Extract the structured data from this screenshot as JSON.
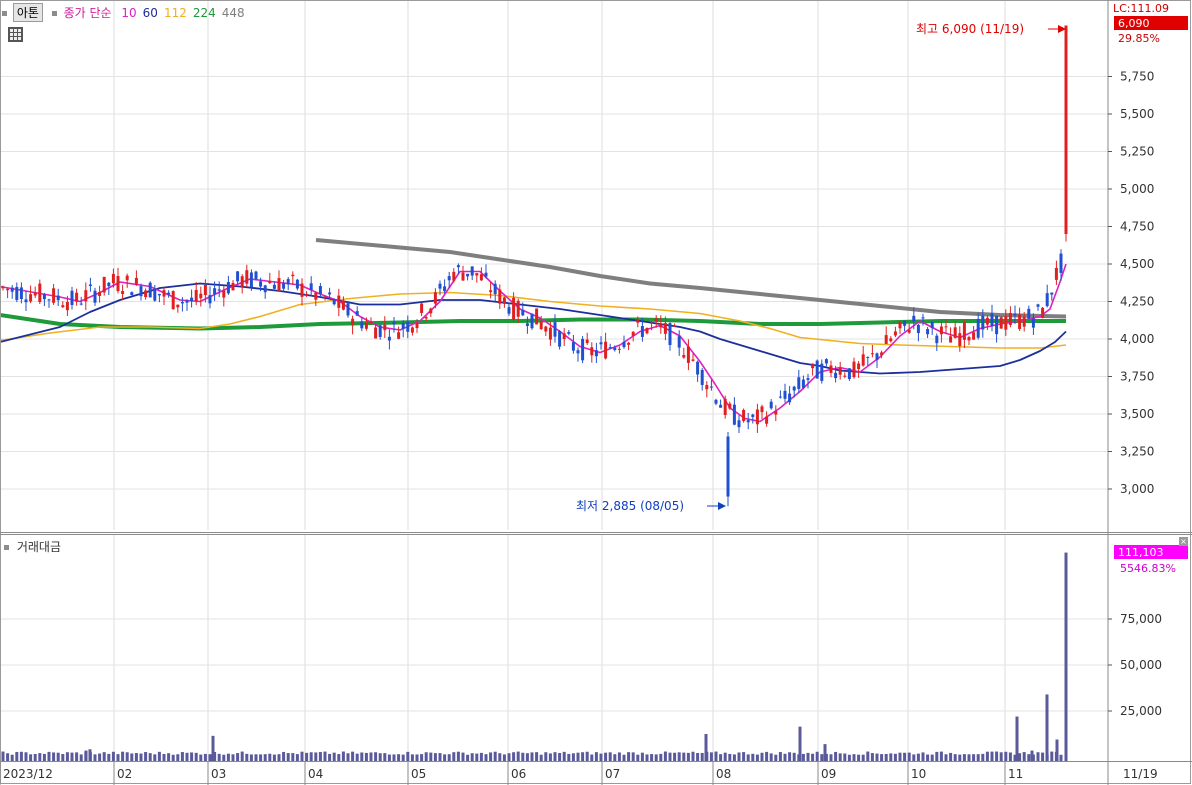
{
  "header": {
    "stock_button": "아톤",
    "ma_title": "종가 단순",
    "ma_periods": [
      "10",
      "60",
      "112",
      "224",
      "448"
    ],
    "ma_colors": [
      "#e020c0",
      "#1c2f9c",
      "#f0b020",
      "#1f9a3a",
      "#7f7f7f"
    ]
  },
  "volume_panel": {
    "title": "거래대금"
  },
  "price_axis": {
    "corner_label": "LC:111.09",
    "current_tag": "6,090",
    "current_pct": "29.85%",
    "tick_labels": [
      "5,750",
      "5,500",
      "5,250",
      "5,000",
      "4,750",
      "4,500",
      "4,250",
      "4,000",
      "3,750",
      "3,500",
      "3,250",
      "3,000"
    ],
    "ticks": [
      5750,
      5500,
      5250,
      5000,
      4750,
      4500,
      4250,
      4000,
      3750,
      3500,
      3250,
      3000
    ]
  },
  "volume_axis": {
    "current_tag": "111,103",
    "current_pct": "5546.83%",
    "tick_labels": [
      "75,000",
      "50,000",
      "25,000"
    ],
    "ticks": [
      75000,
      50000,
      25000
    ]
  },
  "time_axis": {
    "labels": [
      "2023/12",
      "02",
      "03",
      "04",
      "05",
      "06",
      "07",
      "08",
      "09",
      "10",
      "11"
    ],
    "right_label": "11/19"
  },
  "annotations": {
    "high_text": "최고 6,090 (11/19)",
    "low_text": "최저 2,885 (08/05)"
  },
  "colors": {
    "up": "#e02020",
    "down": "#2050d0",
    "volume": "#5a5a9a",
    "highlight": "#ff00ff",
    "price_tag": "#e00000"
  },
  "chart_data": {
    "type": "candlestick",
    "price_range": [
      2800,
      6100
    ],
    "volume_range": [
      0,
      115000
    ],
    "high": {
      "value": 6090,
      "date": "11/19"
    },
    "low": {
      "value": 2885,
      "date": "08/05"
    },
    "last_close": 6090,
    "last_volume": 111103,
    "series": [
      {
        "name": "10",
        "x": [
          0,
          60,
          80,
          100,
          120,
          150,
          180,
          200,
          225,
          250,
          275,
          300,
          320,
          340,
          360,
          380,
          400,
          420,
          440,
          460,
          480,
          500,
          520,
          540,
          560,
          580,
          600,
          620,
          640,
          660,
          680,
          700,
          715,
          730,
          745,
          760,
          780,
          800,
          820,
          840,
          860,
          880,
          900,
          920,
          940,
          960,
          980,
          1000,
          1020,
          1040,
          1050,
          1060,
          1066
        ],
        "y": [
          4350,
          4280,
          4250,
          4310,
          4380,
          4350,
          4260,
          4250,
          4330,
          4400,
          4380,
          4360,
          4300,
          4250,
          4150,
          4080,
          4060,
          4120,
          4250,
          4450,
          4450,
          4320,
          4200,
          4140,
          4050,
          3950,
          3910,
          3960,
          4050,
          4090,
          4020,
          3850,
          3700,
          3540,
          3470,
          3450,
          3540,
          3650,
          3780,
          3810,
          3780,
          3880,
          4020,
          4120,
          4050,
          4010,
          4070,
          4100,
          4120,
          4150,
          4200,
          4380,
          4500
        ]
      },
      {
        "name": "60",
        "x": [
          0,
          60,
          90,
          120,
          160,
          200,
          240,
          280,
          320,
          360,
          400,
          440,
          480,
          520,
          560,
          600,
          640,
          680,
          700,
          720,
          740,
          760,
          780,
          800,
          820,
          840,
          880,
          920,
          960,
          1000,
          1020,
          1040,
          1055,
          1066
        ],
        "y": [
          3980,
          4080,
          4180,
          4260,
          4340,
          4370,
          4350,
          4320,
          4280,
          4230,
          4230,
          4260,
          4260,
          4230,
          4200,
          4160,
          4120,
          4080,
          4050,
          4000,
          3960,
          3920,
          3880,
          3840,
          3820,
          3790,
          3770,
          3780,
          3800,
          3820,
          3860,
          3920,
          3980,
          4050
        ]
      },
      {
        "name": "112",
        "x": [
          0,
          50,
          100,
          150,
          200,
          230,
          260,
          300,
          350,
          400,
          450,
          500,
          550,
          600,
          650,
          700,
          740,
          770,
          800,
          830,
          860,
          900,
          950,
          1000,
          1040,
          1066
        ],
        "y": [
          3990,
          4040,
          4080,
          4080,
          4070,
          4100,
          4150,
          4230,
          4270,
          4300,
          4310,
          4290,
          4250,
          4220,
          4200,
          4170,
          4120,
          4070,
          4010,
          3990,
          3970,
          3960,
          3950,
          3940,
          3940,
          3960
        ]
      },
      {
        "name": "224",
        "x": [
          0,
          60,
          120,
          200,
          260,
          320,
          400,
          460,
          520,
          580,
          640,
          700,
          760,
          820,
          880,
          940,
          1000,
          1066
        ],
        "y": [
          4160,
          4100,
          4080,
          4070,
          4080,
          4100,
          4110,
          4120,
          4120,
          4130,
          4130,
          4120,
          4100,
          4100,
          4110,
          4120,
          4120,
          4120
        ]
      },
      {
        "name": "448",
        "x": [
          316,
          400,
          450,
          500,
          550,
          600,
          650,
          700,
          760,
          820,
          880,
          940,
          1000,
          1066
        ],
        "y": [
          4660,
          4610,
          4580,
          4530,
          4480,
          4420,
          4370,
          4340,
          4300,
          4260,
          4220,
          4180,
          4160,
          4150
        ]
      }
    ]
  }
}
